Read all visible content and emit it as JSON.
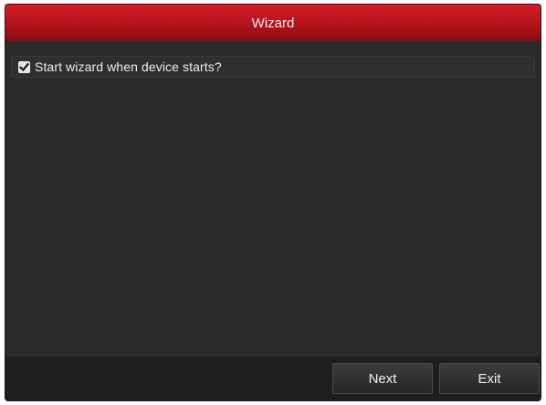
{
  "dialog": {
    "title": "Wizard"
  },
  "option": {
    "label": "Start wizard when device starts?",
    "checked": true
  },
  "footer": {
    "next_label": "Next",
    "exit_label": "Exit"
  },
  "colors": {
    "title_bar": "#c0141f",
    "background": "#2a2a2a",
    "footer": "#1e1e1e"
  },
  "icons": {
    "checkbox": "checkmark-icon"
  }
}
